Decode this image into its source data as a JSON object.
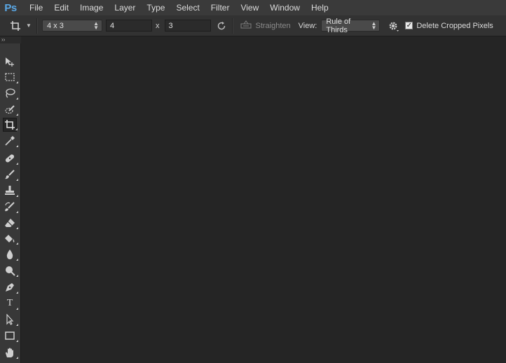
{
  "app": {
    "logo_text": "Ps"
  },
  "menu": [
    "File",
    "Edit",
    "Image",
    "Layer",
    "Type",
    "Select",
    "Filter",
    "View",
    "Window",
    "Help"
  ],
  "options": {
    "ratio_select": "4 x 3",
    "width_value": "4",
    "times_symbol": "x",
    "height_value": "3",
    "straighten_label": "Straighten",
    "view_label": "View:",
    "view_select": "Rule of Thirds",
    "delete_cropped_label": "Delete Cropped Pixels",
    "delete_cropped_checked": true
  },
  "toolbar": {
    "collapse_glyph": "››",
    "tools": [
      {
        "name": "move-tool",
        "icon": "move-icon"
      },
      {
        "name": "marquee-tool",
        "icon": "rect-marquee-icon"
      },
      {
        "name": "lasso-tool",
        "icon": "lasso-icon"
      },
      {
        "name": "quick-selection-tool",
        "icon": "quick-selection-icon"
      },
      {
        "name": "crop-tool",
        "icon": "crop-icon",
        "active": true
      },
      {
        "name": "eyedropper-tool",
        "icon": "eyedropper-icon"
      },
      {
        "name": "healing-brush-tool",
        "icon": "bandage-icon"
      },
      {
        "name": "brush-tool",
        "icon": "brush-icon"
      },
      {
        "name": "clone-stamp-tool",
        "icon": "stamp-icon"
      },
      {
        "name": "history-brush-tool",
        "icon": "history-brush-icon"
      },
      {
        "name": "eraser-tool",
        "icon": "eraser-icon"
      },
      {
        "name": "paint-bucket-tool",
        "icon": "paint-bucket-icon"
      },
      {
        "name": "blur-tool",
        "icon": "drop-icon"
      },
      {
        "name": "dodge-tool",
        "icon": "dodge-icon"
      },
      {
        "name": "pen-tool",
        "icon": "pen-icon"
      },
      {
        "name": "type-tool",
        "icon": "type-icon",
        "label": "T"
      },
      {
        "name": "path-selection-tool",
        "icon": "arrow-cursor-icon"
      },
      {
        "name": "rectangle-tool",
        "icon": "rectangle-icon"
      },
      {
        "name": "hand-tool",
        "icon": "hand-icon"
      }
    ]
  },
  "colors": {
    "menubar_bg": "#3a3a3a",
    "optionsbar_bg": "#323232",
    "canvas_bg": "#252525",
    "ps_logo": "#5aa8e6"
  }
}
